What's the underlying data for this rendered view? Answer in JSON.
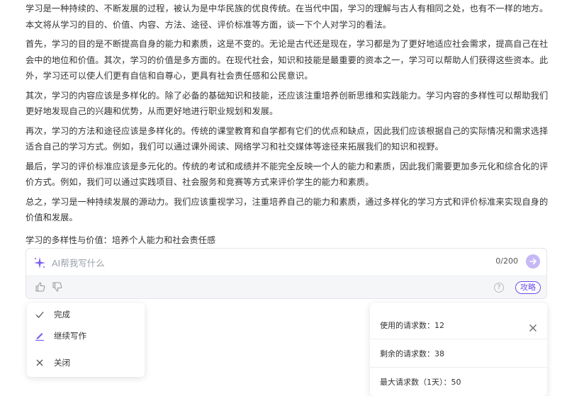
{
  "article": {
    "paragraphs": [
      "学习是一种持续的、不断发展的过程，被认为是中华民族的优良传统。在当代中国，学习的理解与古人有相同之处，也有不一样的地方。本文将从学习的目的、价值、内容、方法、途径、评价标准等方面，谈一下个人对学习的看法。",
      "首先，学习的目的是不断提高自身的能力和素质，这是不变的。无论是古代还是现在，学习都是为了更好地适应社会需求，提高自己在社会中的地位和价值。其次，学习的价值是多方面的。在现代社会，知识和技能是最重要的资本之一，学习可以帮助人们获得这些资本。此外，学习还可以使人们更有自信和自尊心，更具有社会责任感和公民意识。",
      "其次，学习的内容应该是多样化的。除了必备的基础知识和技能，还应该注重培养创新思维和实践能力。学习内容的多样性可以帮助我们更好地发现自己的兴趣和优势，从而更好地进行职业规划和发展。",
      "再次，学习的方法和途径应该是多样化的。传统的课堂教育和自学都有它们的优点和缺点，因此我们应该根据自己的实际情况和需求选择适合自己的学习方式。例如，我们可以通过课外阅读、网络学习和社交媒体等途径来拓展我们的知识和视野。",
      "最后，学习的评价标准应该是多元化的。传统的考试和成绩并不能完全反映一个人的能力和素质，因此我们需要更加多元化和综合化的评价方式。例如，我们可以通过实践项目、社会服务和竞赛等方式来评价学生的能力和素质。",
      "总之，学习是一种持续发展的源动力。我们应该重视学习，注重培养自己的能力和素质，通过多样化的学习方式和评价标准来实现自身的价值和发展。"
    ],
    "subtitle": "学习的多样性与价值：培养个人能力和社会责任感"
  },
  "ai_box": {
    "placeholder": "AI帮我写什么",
    "counter": "0/200",
    "guide_label": "攻略",
    "help_symbol": "?",
    "accent": "#6b4cf0"
  },
  "menu": {
    "items": [
      {
        "label": "完成",
        "icon": "check-icon"
      },
      {
        "label": "继续写作",
        "icon": "pen-icon"
      },
      {
        "label": "关闭",
        "icon": "close-icon"
      }
    ]
  },
  "quota": {
    "used": "使用的请求数：12",
    "remaining": "剩余的请求数：38",
    "max": "最大请求数（1天）：50"
  }
}
